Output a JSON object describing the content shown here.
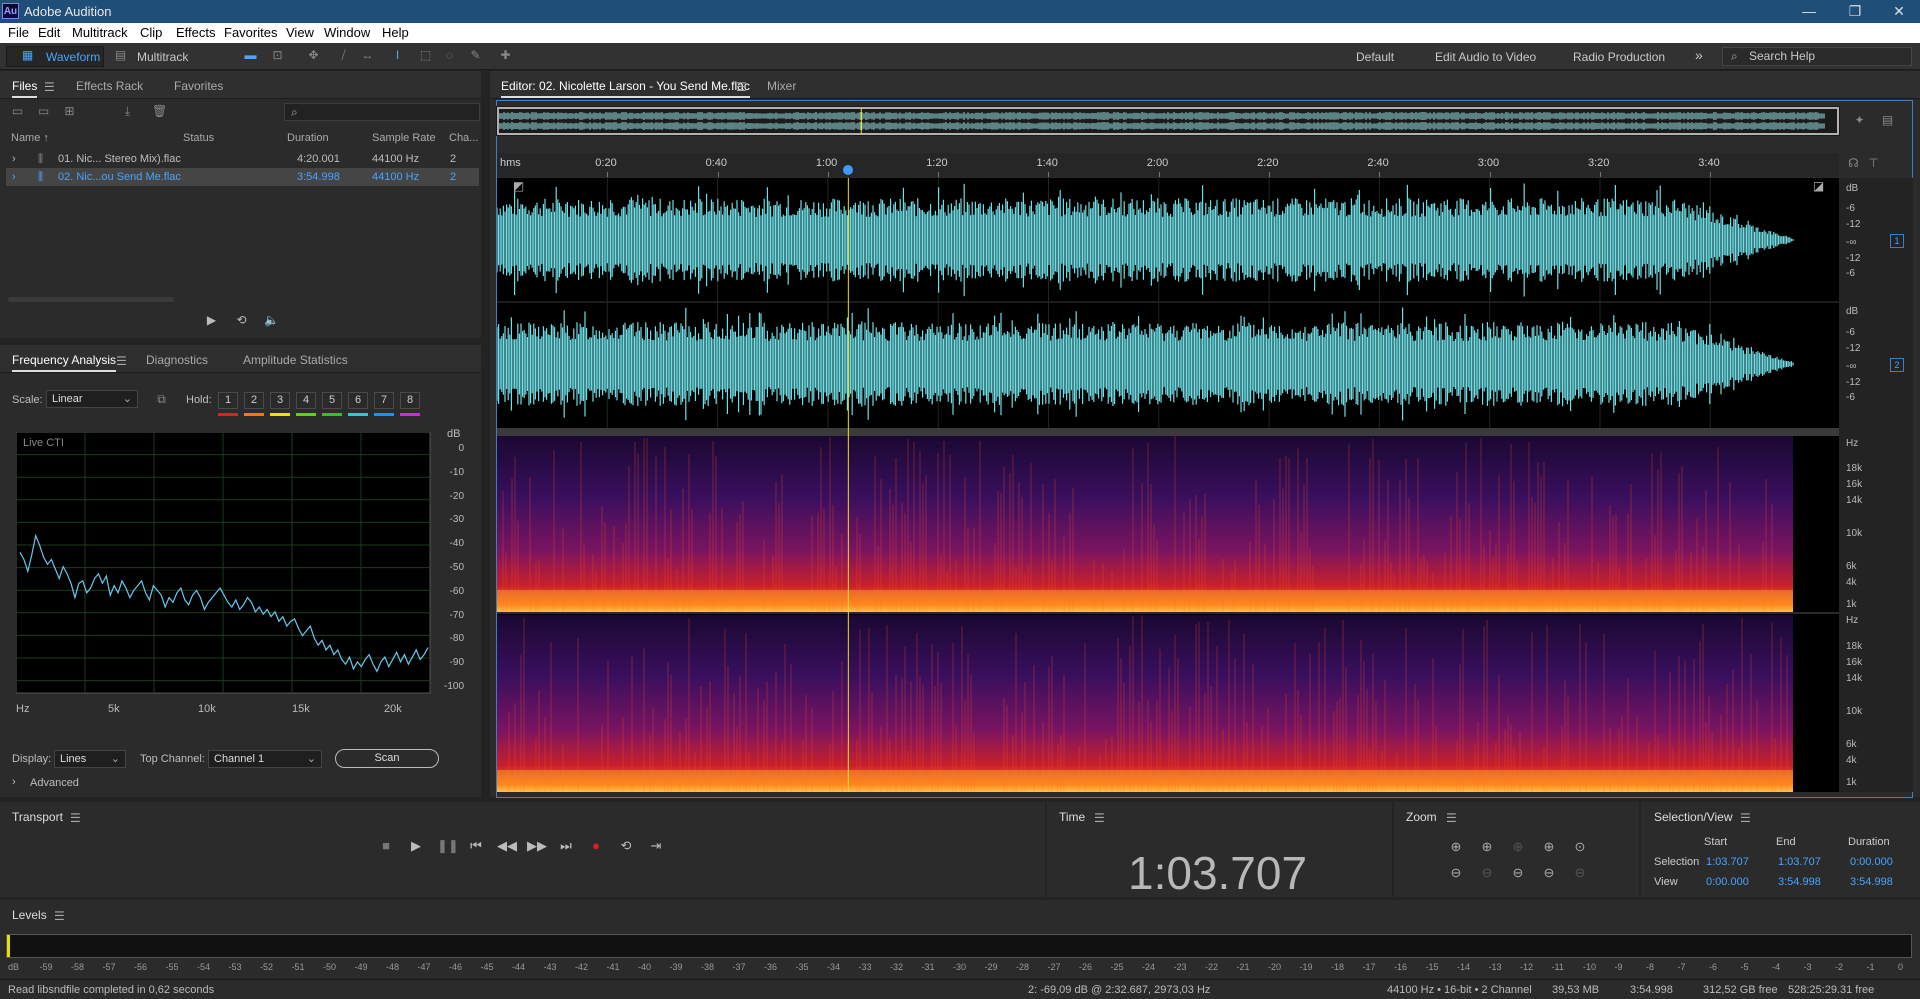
{
  "window": {
    "app_badge": "Au",
    "title": "Adobe Audition",
    "controls": [
      "—",
      "❐",
      "✕"
    ]
  },
  "menu": [
    "File",
    "Edit",
    "Multitrack",
    "Clip",
    "Effects",
    "Favorites",
    "View",
    "Window",
    "Help"
  ],
  "toolbar": {
    "waveform_label": "Waveform",
    "multitrack_label": "Multitrack",
    "workspaces": [
      "Default",
      "Edit Audio to Video",
      "Radio Production"
    ],
    "overflow": "»",
    "search_placeholder": "Search Help"
  },
  "files_panel": {
    "tabs": [
      "Files",
      "Effects Rack",
      "Favorites"
    ],
    "search_icon": "⌕",
    "columns": [
      "Name ↑",
      "Status",
      "Duration",
      "Sample Rate",
      "Cha..."
    ],
    "rows": [
      {
        "name": "01. Nic... Stereo Mix).flac",
        "status": "",
        "duration": "4:20.001",
        "rate": "44100 Hz",
        "channels": "2",
        "selected": false
      },
      {
        "name": "02. Nic...ou Send Me.flac",
        "status": "",
        "duration": "3:54.998",
        "rate": "44100 Hz",
        "channels": "2",
        "selected": true
      }
    ]
  },
  "analysis_panel": {
    "tabs": [
      "Frequency Analysis",
      "Diagnostics",
      "Amplitude Statistics"
    ],
    "scale_label": "Scale:",
    "scale_value": "Linear",
    "hold_label": "Hold:",
    "hold": [
      {
        "n": "1",
        "color": "#e02020"
      },
      {
        "n": "2",
        "color": "#f07a10"
      },
      {
        "n": "3",
        "color": "#f0e000"
      },
      {
        "n": "4",
        "color": "#60d020"
      },
      {
        "n": "5",
        "color": "#30c030"
      },
      {
        "n": "6",
        "color": "#20d0d0"
      },
      {
        "n": "7",
        "color": "#2090f0"
      },
      {
        "n": "8",
        "color": "#e020e0"
      }
    ],
    "graph_caption": "Live CTI",
    "db_unit": "dB",
    "db_ticks": [
      "0",
      "-10",
      "-20",
      "-30",
      "-40",
      "-50",
      "-60",
      "-70",
      "-80",
      "-90",
      "-100"
    ],
    "hz_ticks": [
      "Hz",
      "5k",
      "10k",
      "15k",
      "20k"
    ],
    "spectrum_db": [
      -43,
      -46,
      -51,
      -44,
      -36,
      -40,
      -45,
      -48,
      -46,
      -50,
      -54,
      -49,
      -52,
      -56,
      -62,
      -56,
      -55,
      -60,
      -58,
      -54,
      -52,
      -56,
      -53,
      -61,
      -57,
      -60,
      -55,
      -58,
      -62,
      -59,
      -57,
      -55,
      -60,
      -63,
      -57,
      -59,
      -61,
      -66,
      -62,
      -64,
      -60,
      -58,
      -63,
      -65,
      -61,
      -59,
      -62,
      -67,
      -64,
      -62,
      -60,
      -58,
      -61,
      -64,
      -66,
      -63,
      -67,
      -65,
      -62,
      -64,
      -68,
      -66,
      -69,
      -67,
      -70,
      -68,
      -72,
      -70,
      -74,
      -72,
      -71,
      -75,
      -78,
      -76,
      -74,
      -79,
      -82,
      -80,
      -84,
      -82,
      -86,
      -84,
      -88,
      -90,
      -87,
      -92,
      -89,
      -91,
      -88,
      -86,
      -90,
      -93,
      -89,
      -87,
      -91,
      -88,
      -85,
      -89,
      -86,
      -90,
      -87,
      -84,
      -88,
      -86,
      -83
    ],
    "display_label": "Display:",
    "display_value": "Lines",
    "top_channel_label": "Top Channel:",
    "top_channel_value": "Channel 1",
    "scan_label": "Scan",
    "advanced_label": "Advanced"
  },
  "editor": {
    "tab_title": "Editor: 02. Nicolette Larson - You Send Me.flac",
    "mixer_label": "Mixer",
    "ruler_unit": "hms",
    "ruler_ticks": [
      "0:20",
      "0:40",
      "1:00",
      "1:20",
      "1:40",
      "2:00",
      "2:20",
      "2:40",
      "3:00",
      "3:20",
      "3:40"
    ],
    "duration_seconds": 234.998,
    "playhead_seconds": 63.707,
    "db_labels": [
      "dB",
      "-6",
      "-12",
      "-∞",
      "-12",
      "-6"
    ],
    "channels": [
      "1",
      "2"
    ],
    "hz_labels": [
      "Hz",
      "18k",
      "16k",
      "14k",
      "10k",
      "6k",
      "4k",
      "1k"
    ],
    "colors": {
      "wave": "#6fdfe6",
      "playhead": "#f0e020",
      "spec_low": "#2a0b4a",
      "spec_high": "#ffb030"
    }
  },
  "transport": {
    "title": "Transport",
    "buttons": [
      "■",
      "▶",
      "❚❚",
      "⏮",
      "◀◀",
      "▶▶",
      "⏭",
      "●",
      "⟲",
      "⇥"
    ]
  },
  "time": {
    "title": "Time",
    "value": "1:03.707"
  },
  "zoom": {
    "title": "Zoom"
  },
  "selection_view": {
    "title": "Selection/View",
    "headers": [
      "Start",
      "End",
      "Duration"
    ],
    "rows": [
      {
        "label": "Selection",
        "start": "1:03.707",
        "end": "1:03.707",
        "duration": "0:00.000"
      },
      {
        "label": "View",
        "start": "0:00.000",
        "end": "3:54.998",
        "duration": "3:54.998"
      }
    ]
  },
  "levels": {
    "title": "Levels",
    "ticks": [
      "dB",
      "-59",
      "-58",
      "-57",
      "-56",
      "-55",
      "-54",
      "-53",
      "-52",
      "-51",
      "-50",
      "-49",
      "-48",
      "-47",
      "-46",
      "-45",
      "-44",
      "-43",
      "-42",
      "-41",
      "-40",
      "-39",
      "-38",
      "-37",
      "-36",
      "-35",
      "-34",
      "-33",
      "-32",
      "-31",
      "-30",
      "-29",
      "-28",
      "-27",
      "-26",
      "-25",
      "-24",
      "-23",
      "-22",
      "-21",
      "-20",
      "-19",
      "-18",
      "-17",
      "-16",
      "-15",
      "-14",
      "-13",
      "-12",
      "-11",
      "-10",
      "-9",
      "-8",
      "-7",
      "-6",
      "-5",
      "-4",
      "-3",
      "-2",
      "-1",
      "0"
    ]
  },
  "status": {
    "left": "Read libsndfile completed in 0,62 seconds",
    "cursor": "2: -69,09 dB @ 2:32.687, 2973,03 Hz",
    "format": "44100 Hz • 16-bit • 2 Channel",
    "size": "39,53 MB",
    "duration": "3:54.998",
    "free": "312,52 GB free",
    "free_time": "528:25:29.31 free"
  }
}
